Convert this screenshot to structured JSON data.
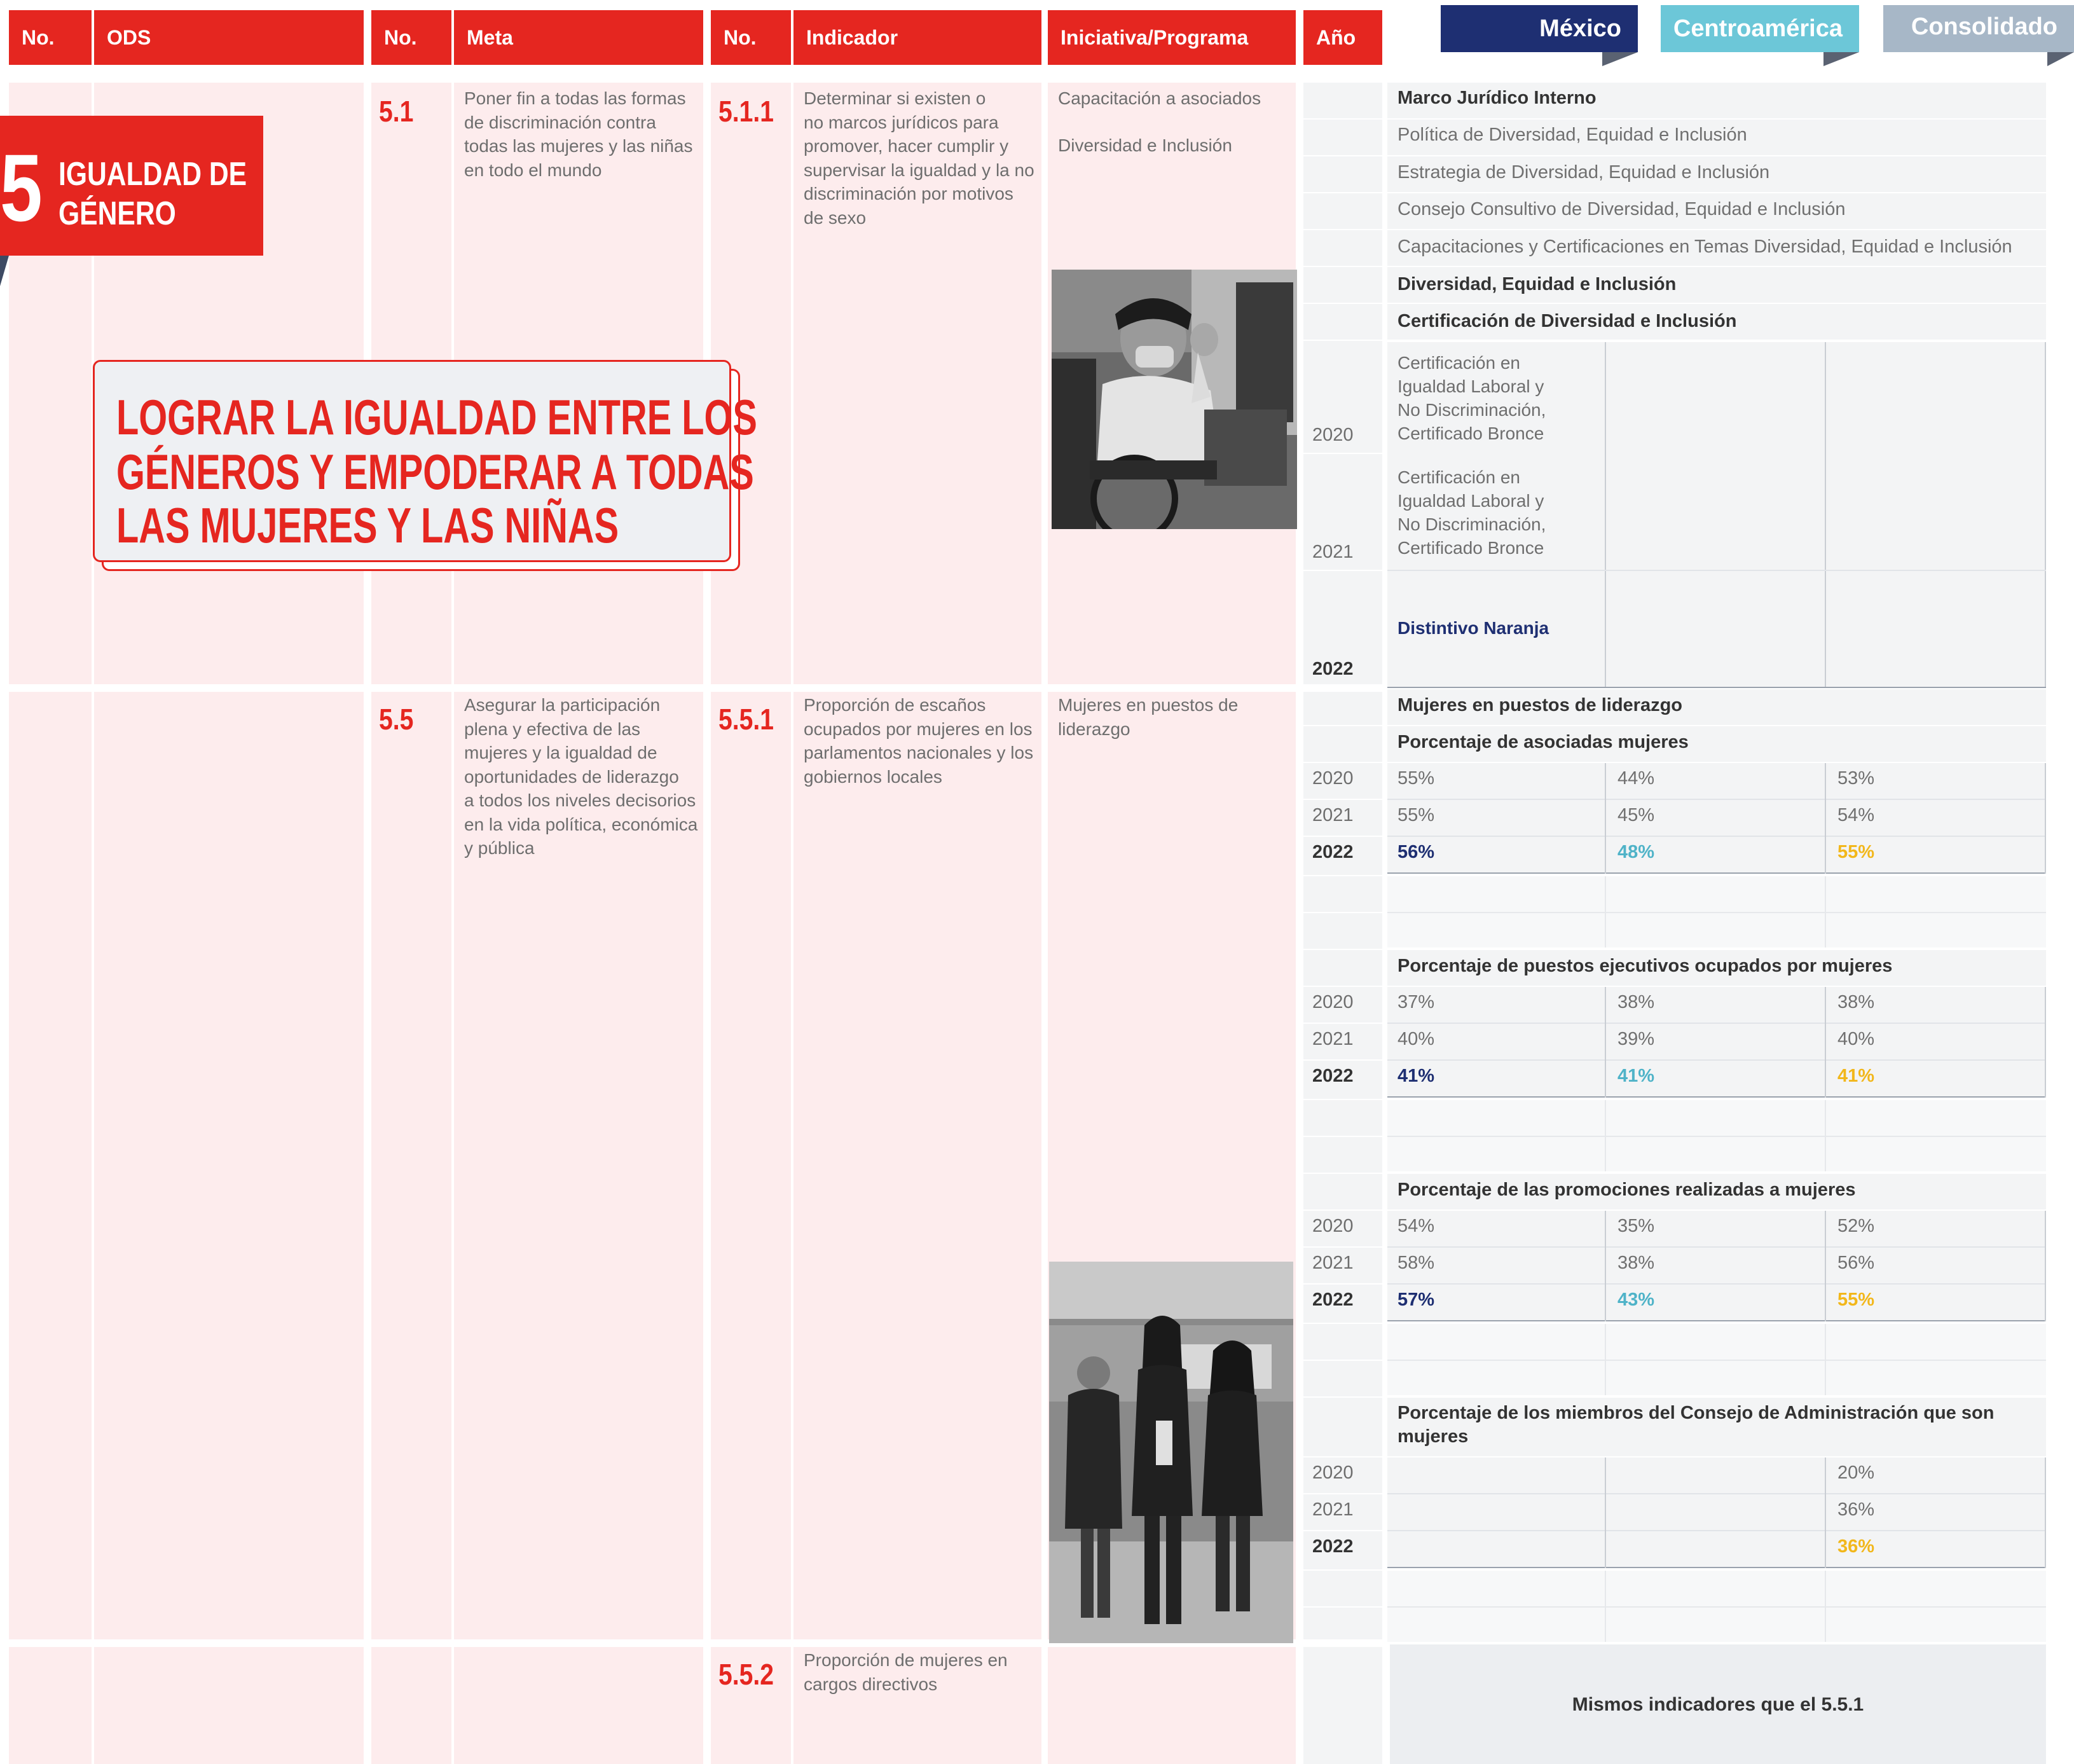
{
  "headers": {
    "no": "No.",
    "ods": "ODS",
    "no2": "No.",
    "meta": "Meta",
    "no3": "No.",
    "indicador": "Indicador",
    "iniciativa": "Iniciativa/Programa",
    "anio": "Año"
  },
  "tabs": {
    "mexico": "México",
    "centroamerica": "Centroamérica",
    "consolidado": "Consolidado"
  },
  "ods": {
    "number": "5",
    "title_line1": "IGUALDAD DE",
    "title_line2": "GÉNERO",
    "goal_line1": "LOGRAR LA IGUALDAD ENTRE LOS",
    "goal_line2": "GÉNEROS Y EMPODERAR A TODAS",
    "goal_line3": "LAS MUJERES Y LAS NIÑAS"
  },
  "colors": {
    "red": "#e52620",
    "pink_bg": "#fdeced",
    "mexico": "#1e2f72",
    "centroamerica": "#6cc7d8",
    "consolidado": "#a7b7c7",
    "gold": "#f2b71b"
  },
  "section1": {
    "meta_no": "5.1",
    "meta_text": [
      "Poner fin a todas las formas",
      "de discriminación contra",
      "todas las mujeres y las niñas",
      "en todo el mundo"
    ],
    "ind_no": "5.1.1",
    "ind_text": [
      "Determinar si existen o",
      "no marcos jurídicos para",
      "promover, hacer cumplir y",
      "supervisar la igualdad y la no",
      "discriminación por motivos",
      "de sexo"
    ],
    "iniciativa1": "Capacitación a asociados",
    "iniciativa2": "Diversidad e Inclusión",
    "rows": {
      "marco": "Marco Jurídico Interno",
      "politica": "Política de Diversidad, Equidad e Inclusión",
      "estrategia": "Estrategia de Diversidad, Equidad e Inclusión",
      "consejo": "Consejo Consultivo de Diversidad, Equidad e Inclusión",
      "capacitaciones": "Capacitaciones y Certificaciones en Temas Diversidad, Equidad e Inclusión",
      "diversidad": "Diversidad, Equidad e Inclusión",
      "certificacion": "Certificación de Diversidad e Inclusión"
    },
    "cert2020": [
      "Certificación en",
      "Igualdad Laboral y",
      "No Discriminación,",
      "Certificado Bronce"
    ],
    "cert2021": [
      "Certificación en",
      "Igualdad Laboral y",
      "No Discriminación,",
      "Certificado Bronce"
    ],
    "distintivo": "Distintivo Naranja",
    "years": [
      "2020",
      "2021",
      "2022"
    ]
  },
  "section2": {
    "meta_no": "5.5",
    "meta_text": [
      "Asegurar la participación",
      "plena y efectiva de las",
      "mujeres y la igualdad de",
      "oportunidades de liderazgo",
      "a todos los niveles decisorios",
      "en la vida política, económica",
      "y pública"
    ],
    "ind_no": "5.5.1",
    "ind_text": [
      "Proporción de escaños",
      "ocupados por mujeres en los",
      "parlamentos nacionales y los",
      "gobiernos locales"
    ],
    "iniciativa": [
      "Mujeres en puestos de",
      "liderazgo"
    ],
    "heading": "Mujeres en puestos de liderazgo",
    "blocks": [
      {
        "title": "Porcentaje de asociadas mujeres",
        "rows": [
          {
            "year": "2020",
            "mx": "55%",
            "ca": "44%",
            "co": "53%"
          },
          {
            "year": "2021",
            "mx": "55%",
            "ca": "45%",
            "co": "54%"
          },
          {
            "year": "2022",
            "mx": "56%",
            "ca": "48%",
            "co": "55%"
          }
        ]
      },
      {
        "title": "Porcentaje de puestos ejecutivos ocupados por mujeres",
        "rows": [
          {
            "year": "2020",
            "mx": "37%",
            "ca": "38%",
            "co": "38%"
          },
          {
            "year": "2021",
            "mx": "40%",
            "ca": "39%",
            "co": "40%"
          },
          {
            "year": "2022",
            "mx": "41%",
            "ca": "41%",
            "co": "41%"
          }
        ]
      },
      {
        "title": "Porcentaje de las promociones realizadas a mujeres",
        "rows": [
          {
            "year": "2020",
            "mx": "54%",
            "ca": "35%",
            "co": "52%"
          },
          {
            "year": "2021",
            "mx": "58%",
            "ca": "38%",
            "co": "56%"
          },
          {
            "year": "2022",
            "mx": "57%",
            "ca": "43%",
            "co": "55%"
          }
        ]
      },
      {
        "title_line1": "Porcentaje de los miembros del Consejo de Administración que son",
        "title_line2": "mujeres",
        "rows": [
          {
            "year": "2020",
            "co": "20%"
          },
          {
            "year": "2021",
            "co": "36%"
          },
          {
            "year": "2022",
            "co": "36%"
          }
        ]
      }
    ]
  },
  "section3": {
    "ind_no": "5.5.2",
    "ind_text": [
      "Proporción de mujeres en",
      "cargos directivos"
    ],
    "note": "Mismos indicadores que el 5.5.1"
  }
}
